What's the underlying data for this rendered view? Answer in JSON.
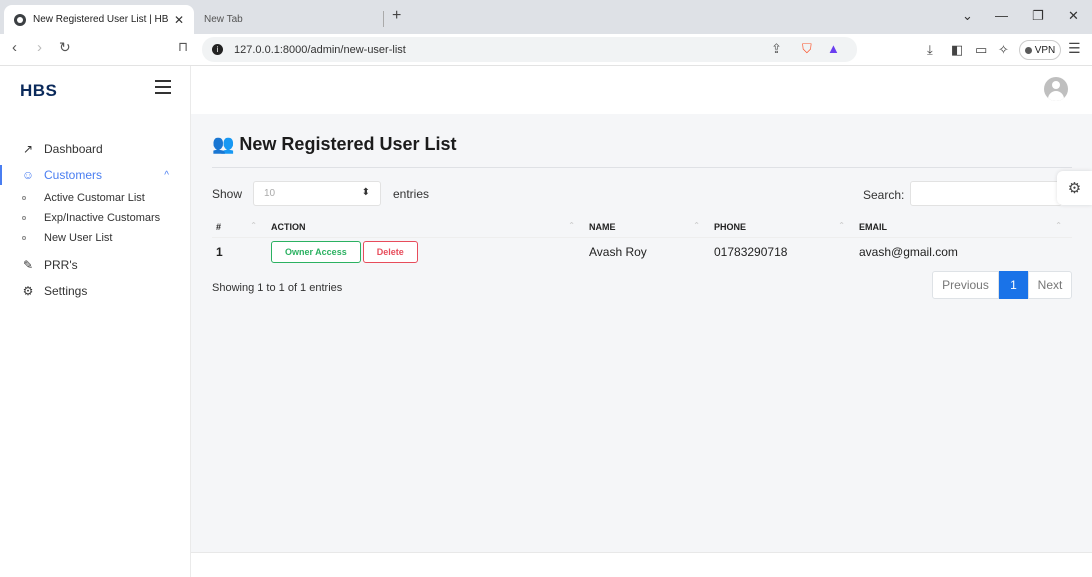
{
  "browser": {
    "active_tab_title": "New Registered User List | HBS",
    "inactive_tab_title": "New Tab",
    "url": "127.0.0.1:8000/admin/new-user-list",
    "vpn_label": "VPN"
  },
  "sidebar": {
    "brand": "HBS",
    "items": [
      {
        "label": "Dashboard",
        "icon": "trend-icon"
      },
      {
        "label": "Customers",
        "icon": "users-icon"
      },
      {
        "label": "PRR's",
        "icon": "edit-icon"
      },
      {
        "label": "Settings",
        "icon": "gear-icon"
      }
    ],
    "sub_items": [
      "Active Customar List",
      "Exp/Inactive Customars",
      "New User List"
    ]
  },
  "main": {
    "title": "New Registered User List",
    "show_label": "Show",
    "entries_value": "10",
    "entries_label": "entries",
    "search_label": "Search:",
    "columns": [
      "#",
      "ACTION",
      "NAME",
      "PHONE",
      "EMAIL"
    ],
    "rows": [
      {
        "idx": "1",
        "owner_label": "Owner Access",
        "delete_label": "Delete",
        "name": "Avash Roy",
        "phone": "01783290718",
        "email": "avash@gmail.com"
      }
    ],
    "info": "Showing 1 to 1 of 1 entries",
    "pagination": {
      "prev": "Previous",
      "current": "1",
      "next": "Next"
    }
  },
  "colors": {
    "accent": "#4a7ef1",
    "success": "#2bb161",
    "danger": "#e74c5b",
    "page_active": "#1a73e8"
  }
}
